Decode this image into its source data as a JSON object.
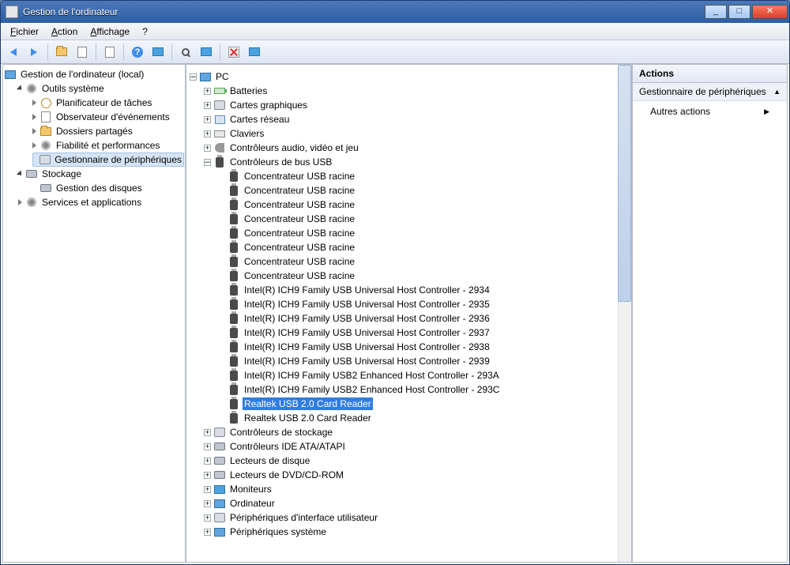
{
  "window": {
    "title": "Gestion de l'ordinateur"
  },
  "menu": {
    "file": "Fichier",
    "action": "Action",
    "view": "Affichage",
    "help": "?"
  },
  "leftTree": {
    "root": "Gestion de l'ordinateur (local)",
    "sysTools": "Outils système",
    "taskSched": "Planificateur de tâches",
    "eventViewer": "Observateur d'événements",
    "sharedFolders": "Dossiers partagés",
    "reliability": "Fiabilité et performances",
    "deviceMgr": "Gestionnaire de périphériques",
    "storage": "Stockage",
    "diskMgmt": "Gestion des disques",
    "services": "Services et applications"
  },
  "center": {
    "root": "PC",
    "batteries": "Batteries",
    "gpu": "Cartes graphiques",
    "nic": "Cartes réseau",
    "keyboards": "Claviers",
    "audio": "Contrôleurs audio, vidéo et jeu",
    "usbBus": "Contrôleurs de bus USB",
    "usbItems": [
      "Concentrateur USB racine",
      "Concentrateur USB racine",
      "Concentrateur USB racine",
      "Concentrateur USB racine",
      "Concentrateur USB racine",
      "Concentrateur USB racine",
      "Concentrateur USB racine",
      "Concentrateur USB racine",
      "Intel(R) ICH9 Family USB Universal Host Controller - 2934",
      "Intel(R) ICH9 Family USB Universal Host Controller - 2935",
      "Intel(R) ICH9 Family USB Universal Host Controller - 2936",
      "Intel(R) ICH9 Family USB Universal Host Controller - 2937",
      "Intel(R) ICH9 Family USB Universal Host Controller - 2938",
      "Intel(R) ICH9 Family USB Universal Host Controller - 2939",
      "Intel(R) ICH9 Family USB2 Enhanced Host Controller - 293A",
      "Intel(R) ICH9 Family USB2 Enhanced Host Controller - 293C",
      "Realtek USB 2.0 Card Reader",
      "Realtek USB 2.0 Card Reader"
    ],
    "usbSelectedIndex": 16,
    "storageCtrl": "Contrôleurs de stockage",
    "ide": "Contrôleurs IDE ATA/ATAPI",
    "diskDrives": "Lecteurs de disque",
    "dvd": "Lecteurs de DVD/CD-ROM",
    "monitors": "Moniteurs",
    "computer": "Ordinateur",
    "hid": "Périphériques d'interface utilisateur",
    "sysDev": "Périphériques système"
  },
  "actions": {
    "header": "Actions",
    "section": "Gestionnaire de périphériques",
    "other": "Autres actions"
  }
}
